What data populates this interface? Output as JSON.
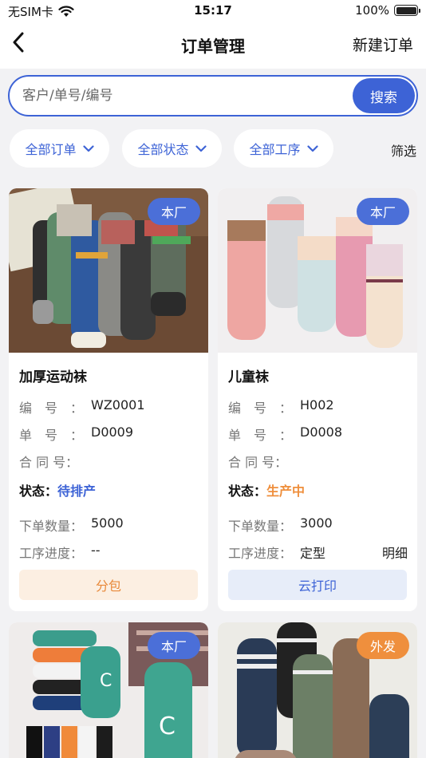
{
  "status_bar": {
    "carrier": "无SIM卡",
    "wifi_icon": "wifi-icon",
    "time": "15:17",
    "battery": "100%"
  },
  "nav": {
    "back_icon": "chevron-left-icon",
    "title": "订单管理",
    "new_order": "新建订单"
  },
  "search": {
    "placeholder": "客户/单号/编号",
    "value": "",
    "button": "搜索"
  },
  "filters": {
    "chips": [
      "全部订单",
      "全部状态",
      "全部工序"
    ],
    "screen": "筛选"
  },
  "labels": {
    "code": "编　号　：",
    "order_no": "单　号　：",
    "contract": "合 同 号：",
    "status": "状态：",
    "quantity": "下单数量：",
    "progress": "工序进度：",
    "detail": "明细"
  },
  "cards": [
    {
      "badge": "本厂",
      "title": "加厚运动袜",
      "code": "WZ0001",
      "order_no": "D0009",
      "contract": "",
      "status": "待排产",
      "status_color": "#3d63d6",
      "quantity": "5000",
      "progress": "--",
      "action": "分包"
    },
    {
      "badge": "本厂",
      "title": "儿童袜",
      "code": "H002",
      "order_no": "D0008",
      "contract": "",
      "status": "生产中",
      "status_color": "#ef8f3d",
      "quantity": "3000",
      "progress": "定型",
      "action": "云打印"
    },
    {
      "badge": "本厂"
    },
    {
      "badge": "外发"
    }
  ],
  "colors": {
    "primary": "#3d63d6",
    "orange": "#ef8f3d",
    "background": "#f2f2f4"
  }
}
